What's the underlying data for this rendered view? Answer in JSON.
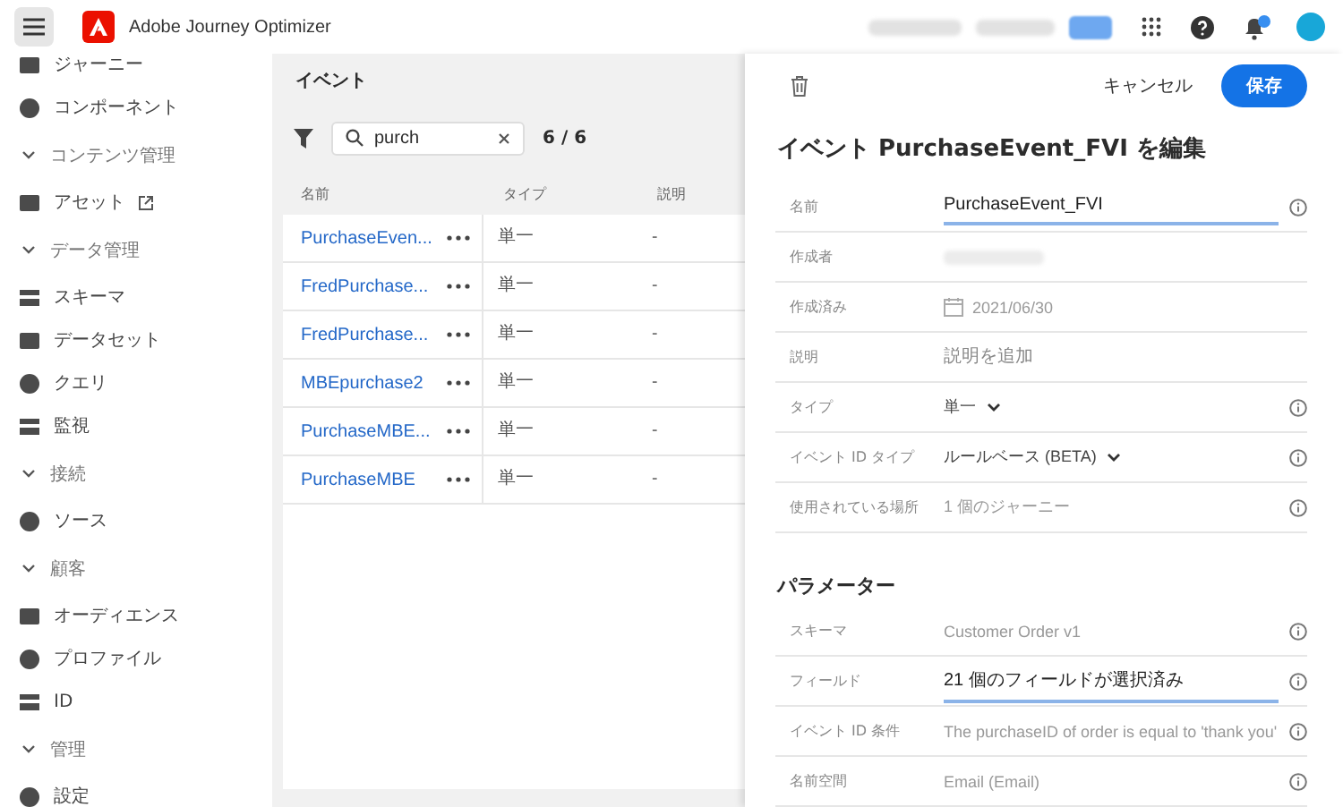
{
  "header": {
    "title": "Adobe Journey Optimizer",
    "notifications": true
  },
  "sidebar": {
    "items": [
      {
        "kind": "item",
        "label": "ジャーニー",
        "external": false
      },
      {
        "kind": "item",
        "label": "コンポーネント",
        "external": false
      },
      {
        "kind": "section",
        "label": "コンテンツ管理"
      },
      {
        "kind": "item",
        "label": "アセット",
        "external": true
      },
      {
        "kind": "section",
        "label": "データ管理"
      },
      {
        "kind": "item",
        "label": "スキーマ",
        "external": false
      },
      {
        "kind": "item",
        "label": "データセット",
        "external": false
      },
      {
        "kind": "item",
        "label": "クエリ",
        "external": false
      },
      {
        "kind": "item",
        "label": "監視",
        "external": false
      },
      {
        "kind": "section",
        "label": "接続"
      },
      {
        "kind": "item",
        "label": "ソース",
        "external": false
      },
      {
        "kind": "section",
        "label": "顧客"
      },
      {
        "kind": "item",
        "label": "オーディエンス",
        "external": false
      },
      {
        "kind": "item",
        "label": "プロファイル",
        "external": false
      },
      {
        "kind": "item",
        "label": "ID",
        "external": false
      },
      {
        "kind": "section",
        "label": "管理"
      },
      {
        "kind": "item",
        "label": "設定",
        "external": false
      }
    ]
  },
  "events": {
    "title": "イベント",
    "search": "purch",
    "count": "6 / 6",
    "columns": [
      "名前",
      "タイプ",
      "説明"
    ],
    "rows": [
      {
        "name": "PurchaseEven...",
        "type": "単一",
        "description": "-"
      },
      {
        "name": "FredPurchase...",
        "type": "単一",
        "description": "-"
      },
      {
        "name": "FredPurchase...",
        "type": "単一",
        "description": "-"
      },
      {
        "name": "MBEpurchase2",
        "type": "単一",
        "description": "-"
      },
      {
        "name": "PurchaseMBE...",
        "type": "単一",
        "description": "-"
      },
      {
        "name": "PurchaseMBE",
        "type": "単一",
        "description": "-"
      }
    ]
  },
  "editor": {
    "cancel": "キャンセル",
    "save": "保存",
    "heading": "イベント PurchaseEvent_FVI を編集",
    "fields": [
      {
        "kind": "input",
        "label": "名前",
        "value": "PurchaseEvent_FVI",
        "info": true
      },
      {
        "kind": "blurred",
        "label": "作成者",
        "info": false
      },
      {
        "kind": "date",
        "label": "作成済み",
        "value": "2021/06/30",
        "info": false
      },
      {
        "kind": "placeholder",
        "label": "説明",
        "placeholder": "説明を追加",
        "info": false
      },
      {
        "kind": "dropdown",
        "label": "タイプ",
        "value": "単一",
        "info": true
      },
      {
        "kind": "dropdown",
        "label": "イベント ID タイプ",
        "value": "ルールベース (BETA)",
        "info": true
      },
      {
        "kind": "readonly",
        "label": "使用されている場所",
        "value": "1 個のジャーニー",
        "info": true
      }
    ],
    "parameters_title": "パラメーター",
    "parameters": [
      {
        "kind": "readonly",
        "label": "スキーマ",
        "value": "Customer Order v1",
        "info": true
      },
      {
        "kind": "input",
        "label": "フィールド",
        "value": "21 個のフィールドが選択済み",
        "info": true
      },
      {
        "kind": "readonly",
        "label": "イベント ID 条件",
        "value": "The purchaseID of order is equal to 'thank you'",
        "info": true
      },
      {
        "kind": "readonly",
        "label": "名前空間",
        "value": "Email (Email)",
        "info": true
      }
    ]
  }
}
